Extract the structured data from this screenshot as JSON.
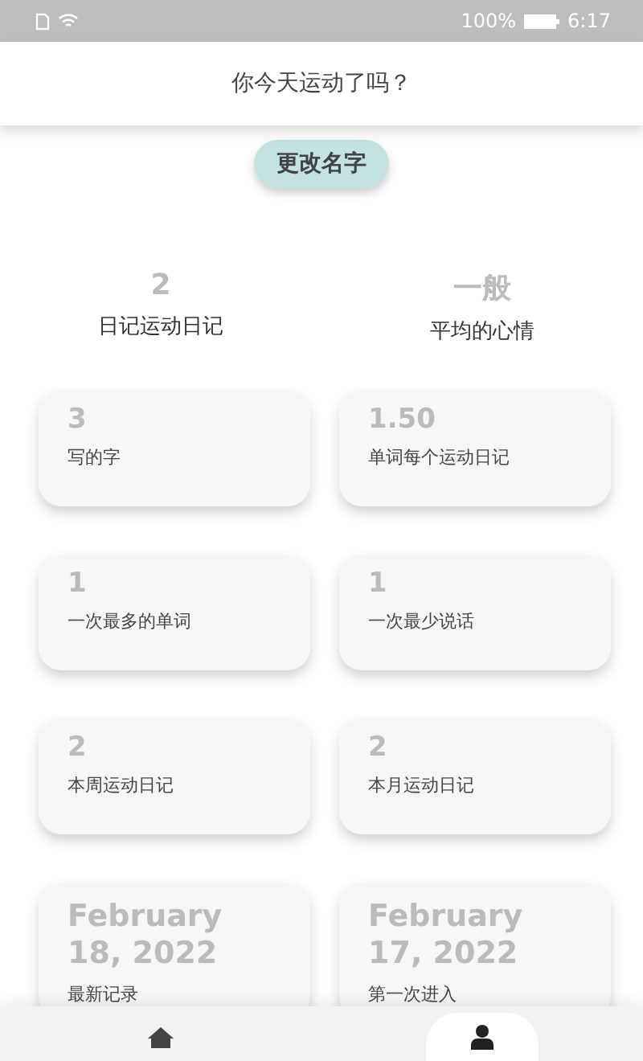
{
  "status_bar": {
    "battery_text": "100%",
    "time": "6:17"
  },
  "header": {
    "title": "你今天运动了吗？"
  },
  "rename_button": "更改名字",
  "summary": [
    {
      "value": "2",
      "label": "日记运动日记"
    },
    {
      "value": "一般",
      "label": "平均的心情"
    }
  ],
  "cards": [
    {
      "value": "3",
      "label": "写的字"
    },
    {
      "value": "1.50",
      "label": "单词每个运动日记"
    },
    {
      "value": "1",
      "label": "一次最多的单词"
    },
    {
      "value": "1",
      "label": "一次最少说话"
    },
    {
      "value": "2",
      "label": "本周运动日记"
    },
    {
      "value": "2",
      "label": "本月运动日记"
    },
    {
      "value": "February 18, 2022",
      "label": "最新记录"
    },
    {
      "value": "February 17, 2022",
      "label": "第一次进入"
    }
  ],
  "bottom_nav": [
    {
      "kind": "home",
      "selected": false
    },
    {
      "kind": "profile",
      "selected": true
    }
  ]
}
